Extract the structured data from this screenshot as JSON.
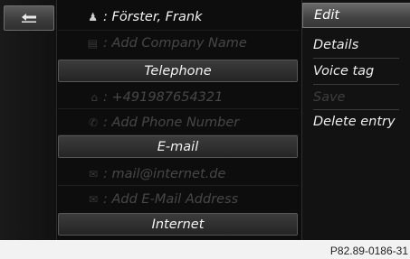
{
  "list": {
    "rows": [
      {
        "icon": "person-icon",
        "glyph": "♟",
        "text": ": Förster, Frank",
        "state": "active"
      },
      {
        "icon": "company-icon",
        "glyph": "▤",
        "text": ": Add Company Name",
        "state": "dim"
      },
      {
        "icon": "",
        "glyph": "",
        "text": "Telephone",
        "state": "header"
      },
      {
        "icon": "home-phone-icon",
        "glyph": "⌂",
        "text": ": +491987654321",
        "state": "dim"
      },
      {
        "icon": "phone-icon",
        "glyph": "✆",
        "text": ": Add Phone Number",
        "state": "dim"
      },
      {
        "icon": "",
        "glyph": "",
        "text": "E-mail",
        "state": "header"
      },
      {
        "icon": "email-icon",
        "glyph": "✉",
        "text": ": mail@internet.de",
        "state": "dim"
      },
      {
        "icon": "email-icon",
        "glyph": "✉",
        "text": ": Add E-Mail Address",
        "state": "dim"
      },
      {
        "icon": "",
        "glyph": "",
        "text": "Internet",
        "state": "header"
      }
    ]
  },
  "menu": {
    "items": [
      {
        "label": "Edit",
        "state": "selected"
      },
      {
        "label": "Details",
        "state": "normal"
      },
      {
        "label": "Voice tag",
        "state": "normal"
      },
      {
        "label": "Save",
        "state": "disabled"
      },
      {
        "label": "Delete entry",
        "state": "normal"
      }
    ]
  },
  "footer": {
    "code": "P82.89-0186-31"
  },
  "icons": {
    "back": "back-arrow-icon"
  },
  "colors": {
    "background": "#0d0d0d",
    "selection": "#555555",
    "text": "#f2f2f2",
    "dimmed": "#474747"
  }
}
